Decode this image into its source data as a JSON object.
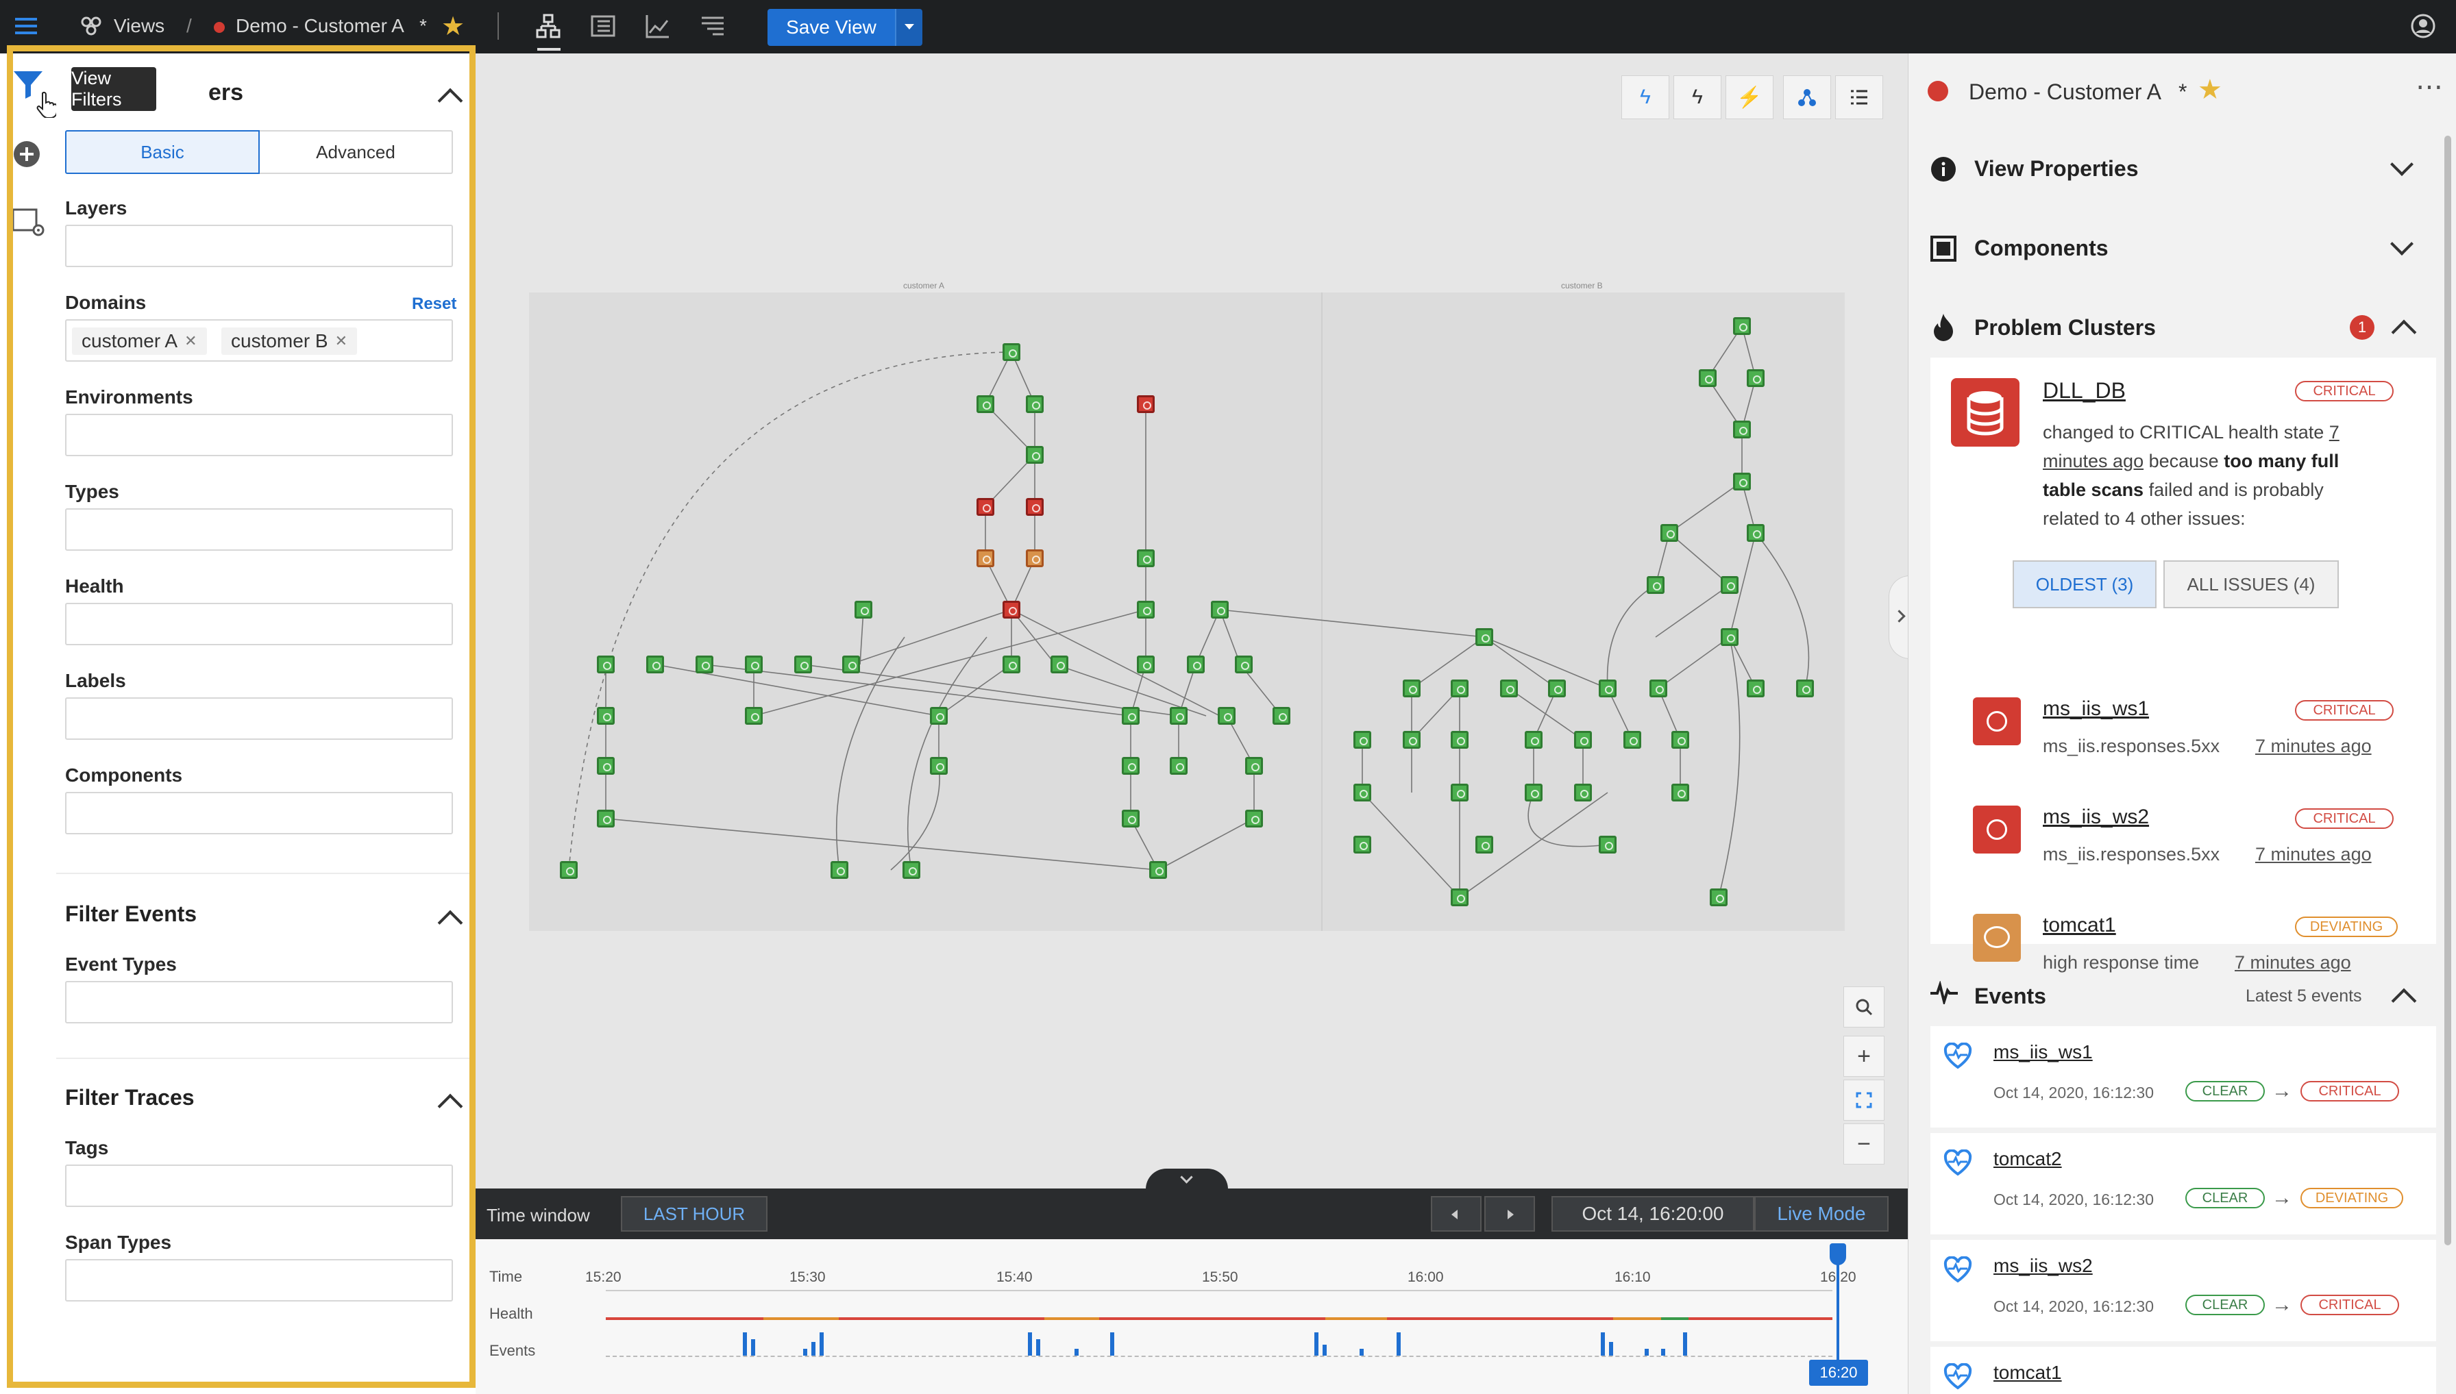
{
  "topbar": {
    "views_label": "Views",
    "view_title": "Demo - Customer A",
    "modified_mark": "*",
    "save_view_label": "Save View"
  },
  "tooltip": {
    "text": "View Filters"
  },
  "filters": {
    "title_partial": "ers",
    "basic_tab": "Basic",
    "advanced_tab": "Advanced",
    "layers_label": "Layers",
    "domains_label": "Domains",
    "reset_label": "Reset",
    "domain_chips": [
      "customer A",
      "customer B"
    ],
    "environments_label": "Environments",
    "types_label": "Types",
    "health_label": "Health",
    "labels_label": "Labels",
    "components_label": "Components",
    "filter_events_title": "Filter Events",
    "event_types_label": "Event Types",
    "filter_traces_title": "Filter Traces",
    "tags_label": "Tags",
    "span_types_label": "Span Types"
  },
  "graph": {
    "left_title": "customer A",
    "right_title": "customer B"
  },
  "timewindow": {
    "label": "Time window",
    "last_hour": "LAST HOUR",
    "datetime": "Oct 14, 16:20:00",
    "live_mode": "Live Mode",
    "row_time": "Time",
    "row_health": "Health",
    "row_events": "Events",
    "ticks": [
      "15:20",
      "15:30",
      "15:40",
      "15:50",
      "16:00",
      "16:10",
      "16:20"
    ],
    "cursor_label": "16:20"
  },
  "rightpanel": {
    "title": "Demo - Customer A",
    "modified_mark": "*",
    "view_properties": "View Properties",
    "components": "Components",
    "problem_clusters": "Problem Clusters",
    "problem_count": "1",
    "cluster": {
      "name": "DLL_DB",
      "badge": "CRITICAL",
      "desc1": "changed to CRITICAL health state",
      "desc_link1": "7",
      "desc_link2": "minutes ago",
      "desc2": "because",
      "desc_bold1": "too many full",
      "desc_bold2": "table scans",
      "desc3": "failed and is probably",
      "desc4": "related to 4 other issues:"
    },
    "tab_oldest": "OLDEST (3)",
    "tab_all": "ALL ISSUES (4)",
    "issues": [
      {
        "name": "ms_iis_ws1",
        "badge": "CRITICAL",
        "detail": "ms_iis.responses.5xx",
        "time": "7 minutes ago"
      },
      {
        "name": "ms_iis_ws2",
        "badge": "CRITICAL",
        "detail": "ms_iis.responses.5xx",
        "time": "7 minutes ago"
      },
      {
        "name": "tomcat1",
        "badge": "DEVIATING",
        "detail": "high response time",
        "time": "7 minutes ago"
      }
    ],
    "events_title": "Events",
    "events_sub": "Latest 5 events",
    "events": [
      {
        "name": "ms_iis_ws1",
        "time": "Oct 14, 2020, 16:12:30",
        "from": "CLEAR",
        "to": "CRITICAL"
      },
      {
        "name": "tomcat2",
        "time": "Oct 14, 2020, 16:12:30",
        "from": "CLEAR",
        "to": "DEVIATING"
      },
      {
        "name": "ms_iis_ws2",
        "time": "Oct 14, 2020, 16:12:30",
        "from": "CLEAR",
        "to": "CRITICAL"
      },
      {
        "name": "tomcat1"
      }
    ]
  },
  "colors": {
    "accent": "#1f6fd1",
    "highlight": "#e7b73a",
    "critical": "#d24c44",
    "deviating": "#e08f2e",
    "clear": "#3a9a4a"
  }
}
